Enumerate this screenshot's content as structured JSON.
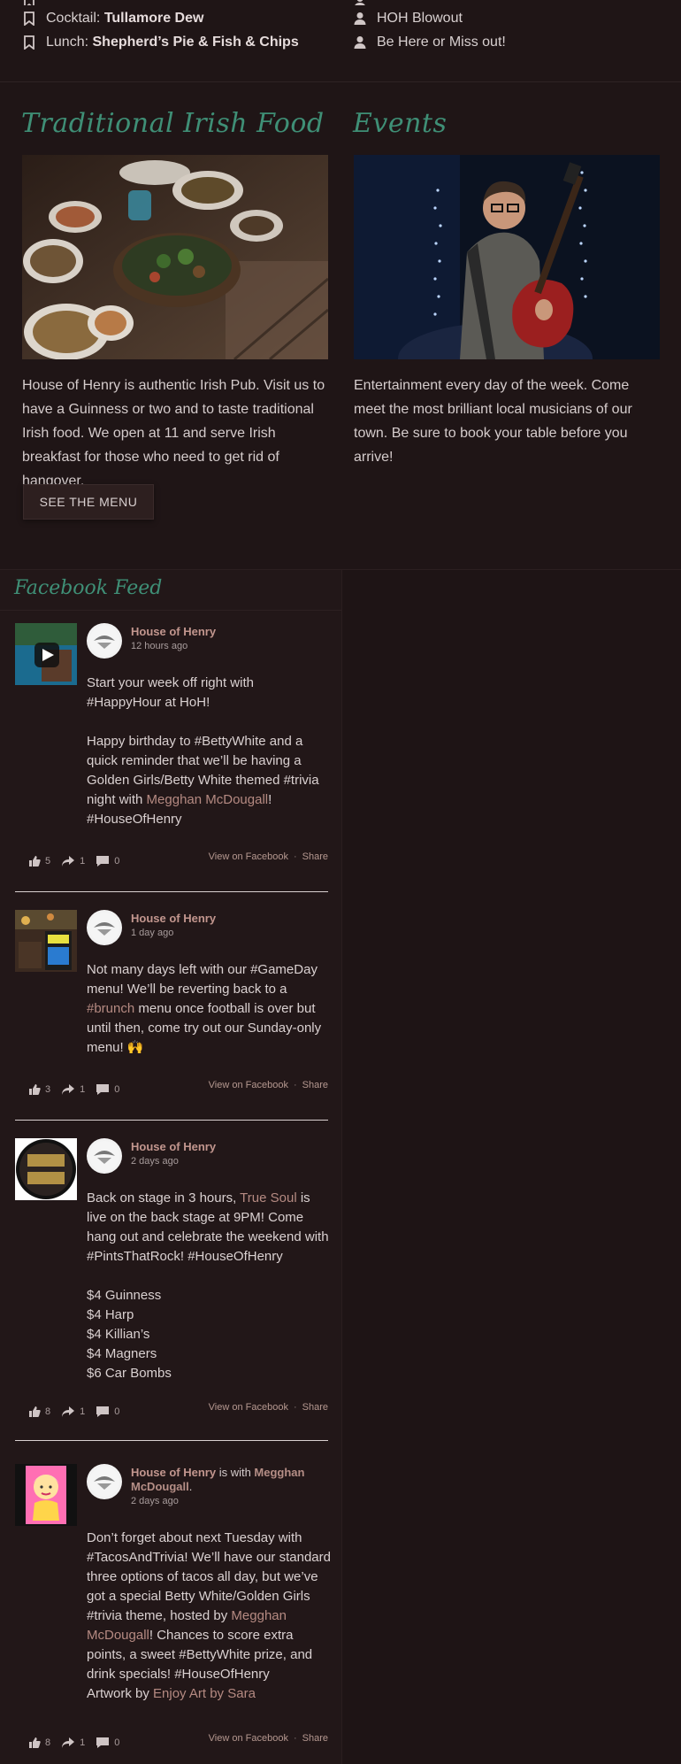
{
  "specials": {
    "left": [
      {
        "label": "Cocktail:",
        "value": "Tullamore Dew"
      },
      {
        "label": "Lunch:",
        "value": "Shepherd’s Pie & Fish & Chips"
      }
    ],
    "right": [
      {
        "value": "HOH Blowout"
      },
      {
        "value": "Be Here or Miss out!"
      }
    ]
  },
  "food": {
    "title": "Traditional Irish Food",
    "text": "House of Henry is authentic Irish Pub. Visit us to have a Guinness or two and to taste traditional Irish food. We open at 11 and serve Irish breakfast for those who need to get rid of hangover.",
    "button": "SEE THE MENU"
  },
  "events": {
    "title": "Events",
    "text": "Entertainment every day of the week. Come meet the most brilliant local musicians of our town. Be sure to book your table before you arrive!"
  },
  "facebook": {
    "title": "Facebook Feed",
    "view_label": "View on Facebook",
    "share_label": "Share",
    "posts": [
      {
        "author": "House of Henry",
        "time": "12 hours ago",
        "text_parts": [
          "Start your week off right with #HappyHour at HoH!\n\nHappy birthday to #BettyWhite and a quick reminder that we’ll be having a Golden Girls/Betty White themed #trivia night with ",
          "Megghan McDougall",
          "! #HouseOfHenry"
        ],
        "likes": "5",
        "shares": "1",
        "comments": "0"
      },
      {
        "author": "House of Henry",
        "time": "1 day ago",
        "text_parts": [
          "Not many days left with our #GameDay menu! We’ll be reverting back to a ",
          "#brunch",
          " menu once football is over but until then, come try out our Sunday-only menu! 🙌"
        ],
        "likes": "3",
        "shares": "1",
        "comments": "0"
      },
      {
        "author": "House of Henry",
        "time": "2 days ago",
        "text_parts": [
          "Back on stage in 3 hours, ",
          "True Soul",
          " is live on the back stage at 9PM! Come hang out and celebrate the weekend with #PintsThatRock! #HouseOfHenry\n\n$4 Guinness\n$4 Harp\n$4 Killian’s\n$4 Magners\n$6 Car Bombs"
        ],
        "likes": "8",
        "shares": "1",
        "comments": "0"
      },
      {
        "author": "House of Henry",
        "with_text": " is with ",
        "with_name": "Megghan McDougall",
        "with_end": ".",
        "time": "2 days ago",
        "text_parts": [
          "Don’t forget about next Tuesday with #TacosAndTrivia! We’ll have our standard three options of tacos all day, but we’ve got a special Betty White/Golden Girls #trivia theme, hosted by ",
          "Megghan McDougall",
          "! Chances to score extra points, a sweet #BettyWhite prize, and drink specials! #HouseOfHenry\nArtwork by ",
          "Enjoy Art by Sara"
        ],
        "likes": "8",
        "shares": "1",
        "comments": "0"
      }
    ]
  },
  "colors": {
    "background": "#1f1516",
    "accent_green": "#3f8f76",
    "link": "#b58a82",
    "author": "#c2968e"
  }
}
